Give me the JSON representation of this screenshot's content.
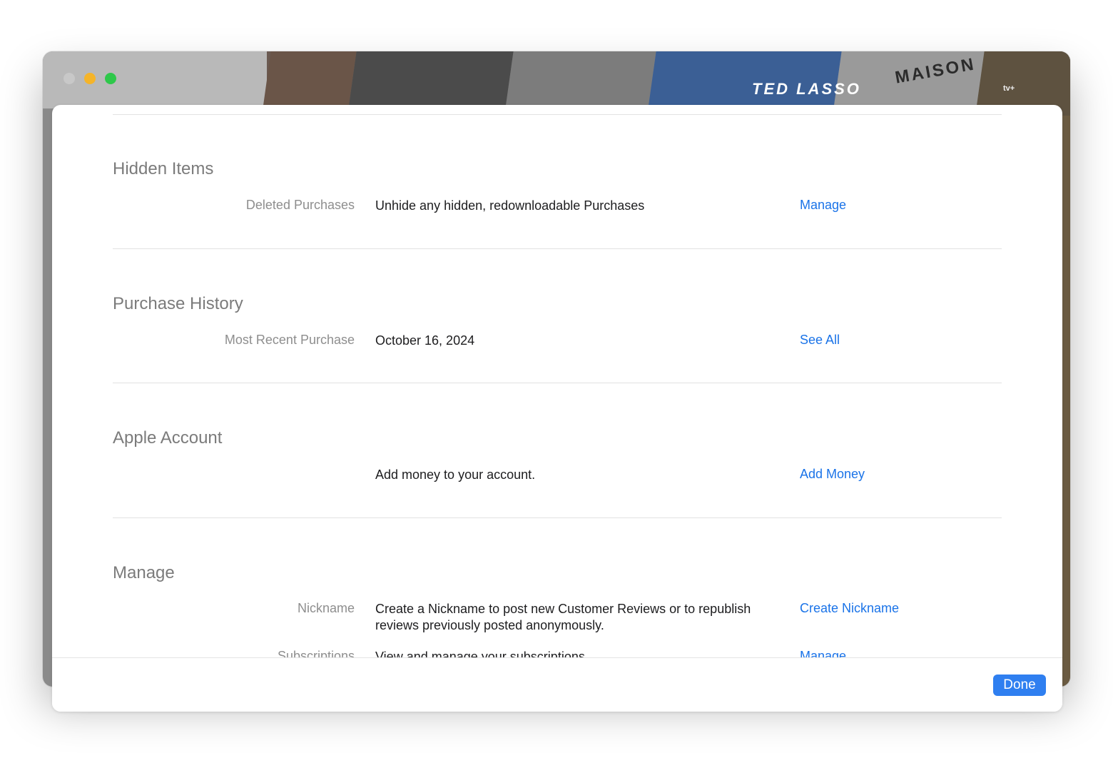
{
  "banner": {
    "show_title": "TED LASSO",
    "maison_title": "MAISON",
    "appletv_badge": "\u0000tv+"
  },
  "sections": [
    {
      "title": "Hidden Items",
      "rows": [
        {
          "label": "Deleted Purchases",
          "value": "Unhide any hidden, redownloadable Purchases",
          "link": "Manage"
        }
      ]
    },
    {
      "title": "Purchase History",
      "rows": [
        {
          "label": "Most Recent Purchase",
          "value": "October 16, 2024",
          "link": "See All"
        }
      ]
    },
    {
      "title": "Apple Account",
      "rows": [
        {
          "label": "",
          "value": "Add money to your account.",
          "link": "Add Money"
        }
      ]
    },
    {
      "title": "Manage",
      "rows": [
        {
          "label": "Nickname",
          "value": "Create a Nickname to post new Customer Reviews or to republish reviews previously posted anonymously.",
          "link": "Create Nickname"
        },
        {
          "label": "Subscriptions",
          "value": "View and manage your subscriptions.",
          "link": "Manage"
        }
      ]
    }
  ],
  "footer": {
    "done_label": "Done"
  },
  "colors": {
    "link": "#1a73e8",
    "done_button": "#2f7ff0",
    "close_disabled": "#c8c8c8",
    "minimize": "#f5b429",
    "zoom": "#2ec84a"
  }
}
